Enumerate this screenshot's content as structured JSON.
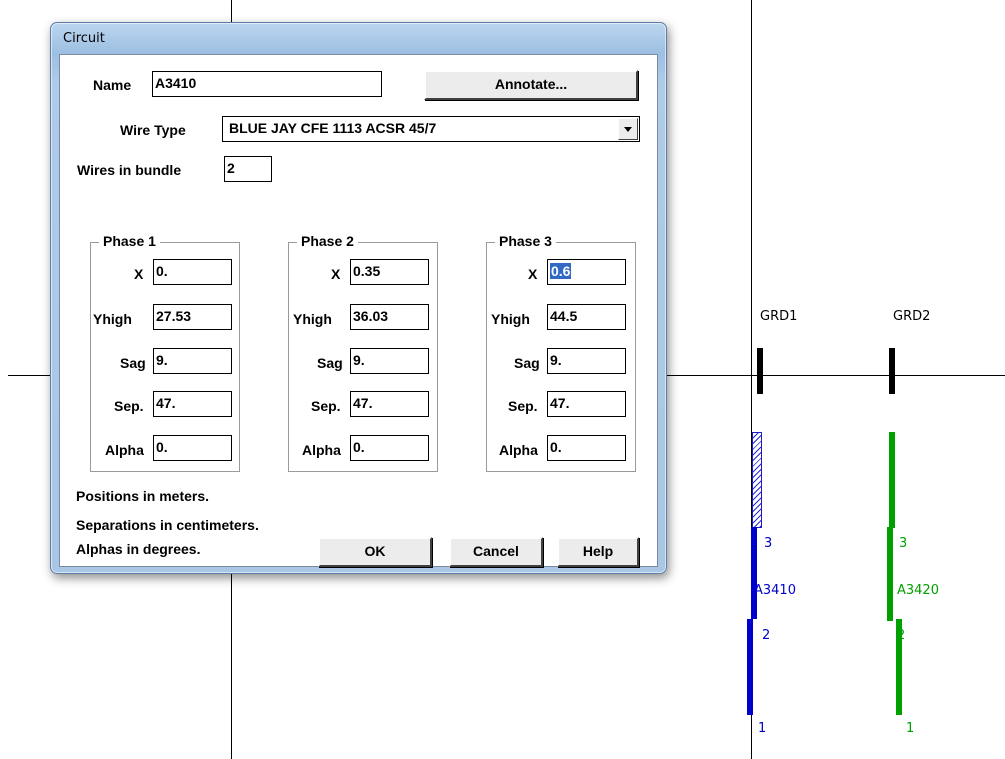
{
  "dialog": {
    "title": "Circuit",
    "name_label": "Name",
    "name_value": "A3410",
    "annotate_label": "Annotate...",
    "wire_type_label": "Wire Type",
    "wire_type_value": "BLUE JAY CFE 1113 ACSR 45/7",
    "wires_bundle_label": "Wires in bundle",
    "wires_bundle_value": "2",
    "field_labels": {
      "x": "X",
      "yhigh": "Yhigh",
      "sag": "Sag",
      "sep": "Sep.",
      "alpha": "Alpha"
    },
    "phases": [
      {
        "title": "Phase 1",
        "x": "0.",
        "yhigh": "27.53",
        "sag": "9.",
        "sep": "47.",
        "alpha": "0."
      },
      {
        "title": "Phase 2",
        "x": "0.35",
        "yhigh": "36.03",
        "sag": "9.",
        "sep": "47.",
        "alpha": "0."
      },
      {
        "title": "Phase 3",
        "x": "0.6",
        "yhigh": "44.5",
        "sag": "9.",
        "sep": "47.",
        "alpha": "0."
      }
    ],
    "notes": [
      "Positions in meters.",
      "Separations in centimeters.",
      "Alphas in degrees."
    ],
    "buttons": {
      "ok": "OK",
      "cancel": "Cancel",
      "help": "Help"
    }
  },
  "drawing": {
    "grounds": [
      "GRD1",
      "GRD2"
    ],
    "circuits": [
      {
        "name": "A3410",
        "color": "#0000cc",
        "phase_labels": [
          "3",
          "2",
          "1"
        ]
      },
      {
        "name": "A3420",
        "color": "#00a000",
        "phase_labels": [
          "3",
          "2",
          "1"
        ]
      }
    ]
  }
}
